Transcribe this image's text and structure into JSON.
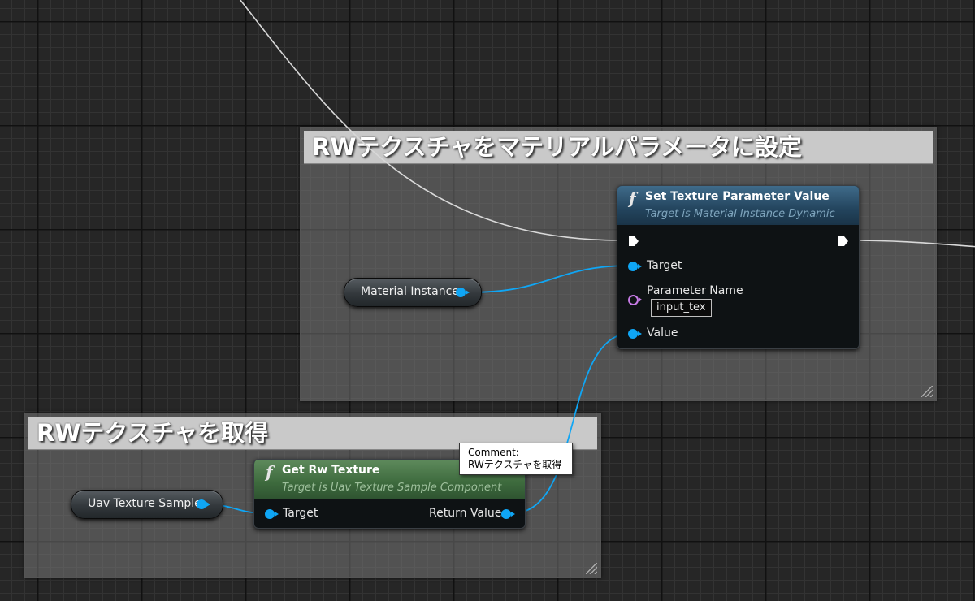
{
  "comments": [
    {
      "id": "set-param",
      "title": "RWテクスチャをマテリアルパラメータに設定"
    },
    {
      "id": "get-tex",
      "title": "RWテクスチャを取得"
    }
  ],
  "nodes": {
    "set_texture": {
      "icon": "function-icon",
      "title": "Set Texture Parameter Value",
      "subtitle": "Target is Material Instance Dynamic",
      "pins": {
        "target": "Target",
        "parameter_name": "Parameter Name",
        "parameter_value": "input_tex",
        "value": "Value"
      }
    },
    "get_rw_texture": {
      "icon": "function-icon",
      "title": "Get Rw Texture",
      "subtitle": "Target is Uav Texture Sample Component",
      "pins": {
        "target": "Target",
        "return_value": "Return Value"
      }
    }
  },
  "variables": {
    "material_instance": "Material Instance",
    "uav_texture_sample": "Uav Texture Sample"
  },
  "tooltip": {
    "line1": "Comment:",
    "line2": "RWテクスチャを取得"
  },
  "colors": {
    "background": "#262626",
    "object_wire": "#0fa6f5",
    "exec_wire": "#d8d8d8",
    "name_pin": "#c77be6",
    "comment_header": "#c9c9c9"
  }
}
